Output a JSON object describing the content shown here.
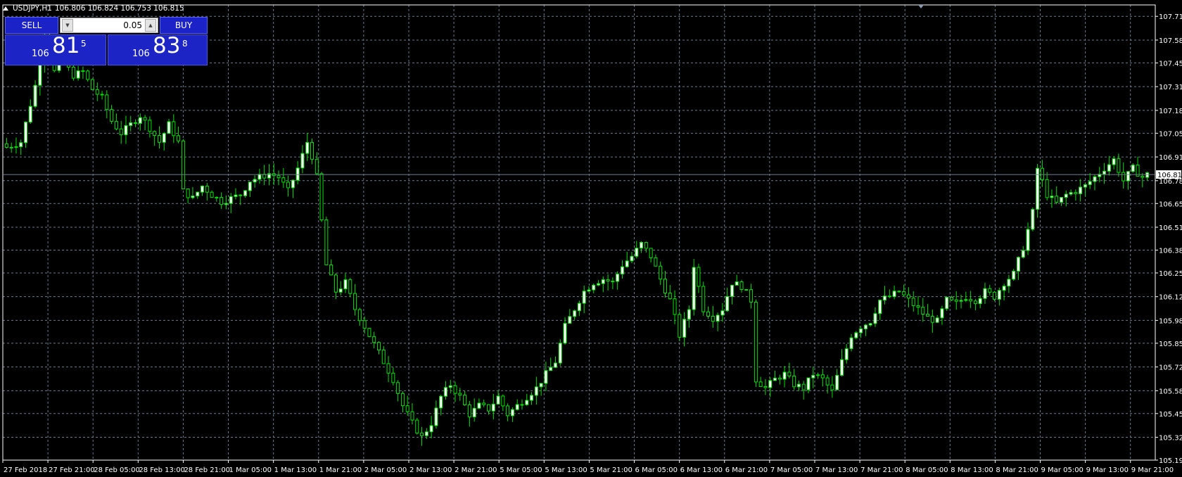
{
  "header": {
    "symbol": "USDJPY,H1",
    "ohlc": "106.806 106.824 106.753 106.815"
  },
  "trade_panel": {
    "sell_label": "SELL",
    "buy_label": "BUY",
    "lot_value": "0.05",
    "sell_price_small": "106",
    "sell_price_big": "81",
    "sell_price_sup": "5",
    "buy_price_small": "106",
    "buy_price_big": "83",
    "buy_price_sup": "8"
  },
  "colors": {
    "background": "#000000",
    "grid": "#6d7a8a",
    "axis": "#ffffff",
    "bull_candle": "#ffffff",
    "bear_candle": "#000000",
    "wick": "#00e000",
    "price_line": "#708090",
    "price_label_bg": "#ffffff",
    "price_label_text": "#000000",
    "panel_button": "#1b23c8"
  },
  "chart_data": {
    "type": "candlestick",
    "title": "USDJPY,H1",
    "current_price": "106.815",
    "ylim": [
      105.19,
      107.78
    ],
    "y_ticks": [
      "107.715",
      "107.580",
      "107.450",
      "107.315",
      "107.180",
      "107.050",
      "106.915",
      "106.815",
      "106.780",
      "106.650",
      "106.515",
      "106.385",
      "106.255",
      "106.120",
      "105.985",
      "105.855",
      "105.720",
      "105.585",
      "105.455",
      "105.320",
      "105.190"
    ],
    "x_labels": [
      "27 Feb 2018",
      "27 Feb 21:00",
      "28 Feb 05:00",
      "28 Feb 13:00",
      "28 Feb 21:00",
      "1 Mar 05:00",
      "1 Mar 13:00",
      "1 Mar 21:00",
      "2 Mar 05:00",
      "2 Mar 13:00",
      "2 Mar 21:00",
      "5 Mar 05:00",
      "5 Mar 13:00",
      "5 Mar 21:00",
      "6 Mar 05:00",
      "6 Mar 13:00",
      "6 Mar 21:00",
      "7 Mar 05:00",
      "7 Mar 13:00",
      "7 Mar 21:00",
      "8 Mar 05:00",
      "8 Mar 13:00",
      "8 Mar 21:00",
      "9 Mar 05:00",
      "9 Mar 13:00",
      "9 Mar 21:00"
    ],
    "grid": true,
    "close_path": [
      [
        0,
        106.97
      ],
      [
        3,
        107.0
      ],
      [
        6,
        107.32
      ],
      [
        8,
        107.62
      ],
      [
        10,
        107.4
      ],
      [
        12,
        107.45
      ],
      [
        14,
        107.38
      ],
      [
        16,
        107.4
      ],
      [
        18,
        107.3
      ],
      [
        20,
        107.25
      ],
      [
        22,
        107.12
      ],
      [
        24,
        107.05
      ],
      [
        26,
        107.1
      ],
      [
        28,
        107.15
      ],
      [
        30,
        107.08
      ],
      [
        32,
        107.0
      ],
      [
        34,
        107.1
      ],
      [
        36,
        107.0
      ],
      [
        37,
        106.72
      ],
      [
        39,
        106.68
      ],
      [
        41,
        106.75
      ],
      [
        43,
        106.7
      ],
      [
        45,
        106.66
      ],
      [
        47,
        106.68
      ],
      [
        49,
        106.7
      ],
      [
        51,
        106.78
      ],
      [
        53,
        106.8
      ],
      [
        55,
        106.82
      ],
      [
        57,
        106.8
      ],
      [
        59,
        106.72
      ],
      [
        61,
        106.85
      ],
      [
        63,
        107.0
      ],
      [
        64,
        106.92
      ],
      [
        65,
        106.8
      ],
      [
        67,
        106.3
      ],
      [
        69,
        106.15
      ],
      [
        71,
        106.2
      ],
      [
        73,
        106.05
      ],
      [
        75,
        105.95
      ],
      [
        77,
        105.85
      ],
      [
        79,
        105.75
      ],
      [
        81,
        105.65
      ],
      [
        83,
        105.5
      ],
      [
        85,
        105.4
      ],
      [
        87,
        105.32
      ],
      [
        89,
        105.4
      ],
      [
        91,
        105.55
      ],
      [
        93,
        105.62
      ],
      [
        95,
        105.55
      ],
      [
        97,
        105.45
      ],
      [
        99,
        105.5
      ],
      [
        101,
        105.48
      ],
      [
        103,
        105.55
      ],
      [
        105,
        105.45
      ],
      [
        107,
        105.5
      ],
      [
        109,
        105.55
      ],
      [
        111,
        105.6
      ],
      [
        113,
        105.68
      ],
      [
        115,
        105.75
      ],
      [
        117,
        105.95
      ],
      [
        119,
        106.05
      ],
      [
        121,
        106.15
      ],
      [
        123,
        106.2
      ],
      [
        125,
        106.22
      ],
      [
        127,
        106.2
      ],
      [
        129,
        106.3
      ],
      [
        131,
        106.35
      ],
      [
        133,
        106.42
      ],
      [
        135,
        106.35
      ],
      [
        137,
        106.22
      ],
      [
        139,
        106.1
      ],
      [
        141,
        105.9
      ],
      [
        143,
        106.05
      ],
      [
        144,
        106.3
      ],
      [
        146,
        106.05
      ],
      [
        148,
        106.0
      ],
      [
        150,
        106.05
      ],
      [
        152,
        106.2
      ],
      [
        154,
        106.18
      ],
      [
        156,
        106.1
      ],
      [
        157,
        105.65
      ],
      [
        159,
        105.6
      ],
      [
        161,
        105.65
      ],
      [
        163,
        105.68
      ],
      [
        165,
        105.62
      ],
      [
        167,
        105.6
      ],
      [
        169,
        105.68
      ],
      [
        171,
        105.65
      ],
      [
        173,
        105.58
      ],
      [
        175,
        105.75
      ],
      [
        177,
        105.9
      ],
      [
        179,
        105.95
      ],
      [
        181,
        105.98
      ],
      [
        183,
        106.1
      ],
      [
        185,
        106.12
      ],
      [
        187,
        106.15
      ],
      [
        189,
        106.1
      ],
      [
        191,
        106.05
      ],
      [
        193,
        106.0
      ],
      [
        195,
        105.98
      ],
      [
        197,
        106.1
      ],
      [
        199,
        106.08
      ],
      [
        201,
        106.12
      ],
      [
        203,
        106.1
      ],
      [
        205,
        106.15
      ],
      [
        207,
        106.12
      ],
      [
        209,
        106.2
      ],
      [
        211,
        106.25
      ],
      [
        213,
        106.4
      ],
      [
        215,
        106.6
      ],
      [
        216,
        106.85
      ],
      [
        218,
        106.7
      ],
      [
        220,
        106.65
      ],
      [
        222,
        106.7
      ],
      [
        224,
        106.72
      ],
      [
        226,
        106.75
      ],
      [
        228,
        106.8
      ],
      [
        230,
        106.85
      ],
      [
        232,
        106.9
      ],
      [
        234,
        106.78
      ],
      [
        236,
        106.85
      ],
      [
        238,
        106.8
      ],
      [
        239,
        106.815
      ]
    ]
  }
}
